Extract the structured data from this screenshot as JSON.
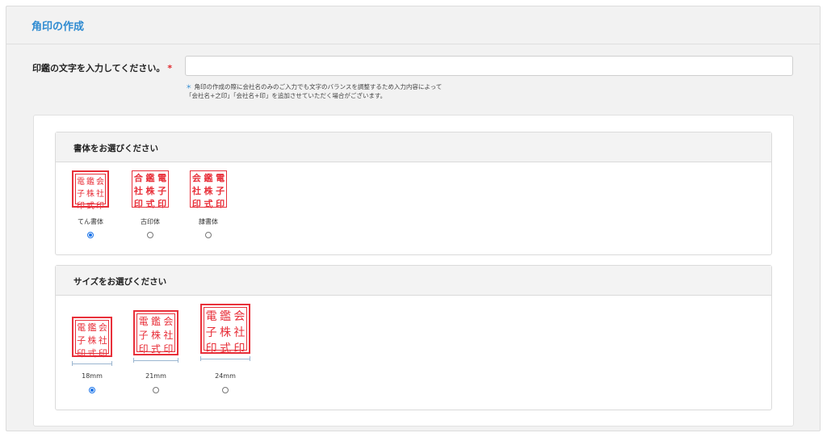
{
  "panel": {
    "title": "角印の作成"
  },
  "input": {
    "label": "印鑑の文字を入力してください。",
    "required_mark": "*",
    "value": "",
    "note_mark": "＊",
    "note_line1": "角印の作成の際に会社名のみのご入力でも文字のバランスを調整するため入力内容によって",
    "note_line2": "「会社名+之印」「会社名+印」を追加させていただく場合がございます。"
  },
  "font_section": {
    "title": "書体をお選びください",
    "options": [
      {
        "label": "てん書体",
        "selected": true,
        "glyphs": [
          "電",
          "鑑",
          "会",
          "子",
          "株",
          "社",
          "印",
          "式",
          "印"
        ]
      },
      {
        "label": "古印体",
        "selected": false,
        "glyphs": [
          "合",
          "鑑",
          "電",
          "社",
          "株",
          "子",
          "印",
          "式",
          "印"
        ]
      },
      {
        "label": "隷書体",
        "selected": false,
        "glyphs": [
          "会",
          "鑑",
          "電",
          "社",
          "株",
          "子",
          "印",
          "式",
          "印"
        ]
      }
    ]
  },
  "size_section": {
    "title": "サイズをお選びください",
    "options": [
      {
        "label": "18mm",
        "selected": true
      },
      {
        "label": "21mm",
        "selected": false
      },
      {
        "label": "24mm",
        "selected": false
      }
    ]
  },
  "colors": {
    "accent": "#2f8bd1",
    "seal_red": "#e8303a",
    "required": "#e0282c",
    "radio_checked": "#1a73e8"
  }
}
